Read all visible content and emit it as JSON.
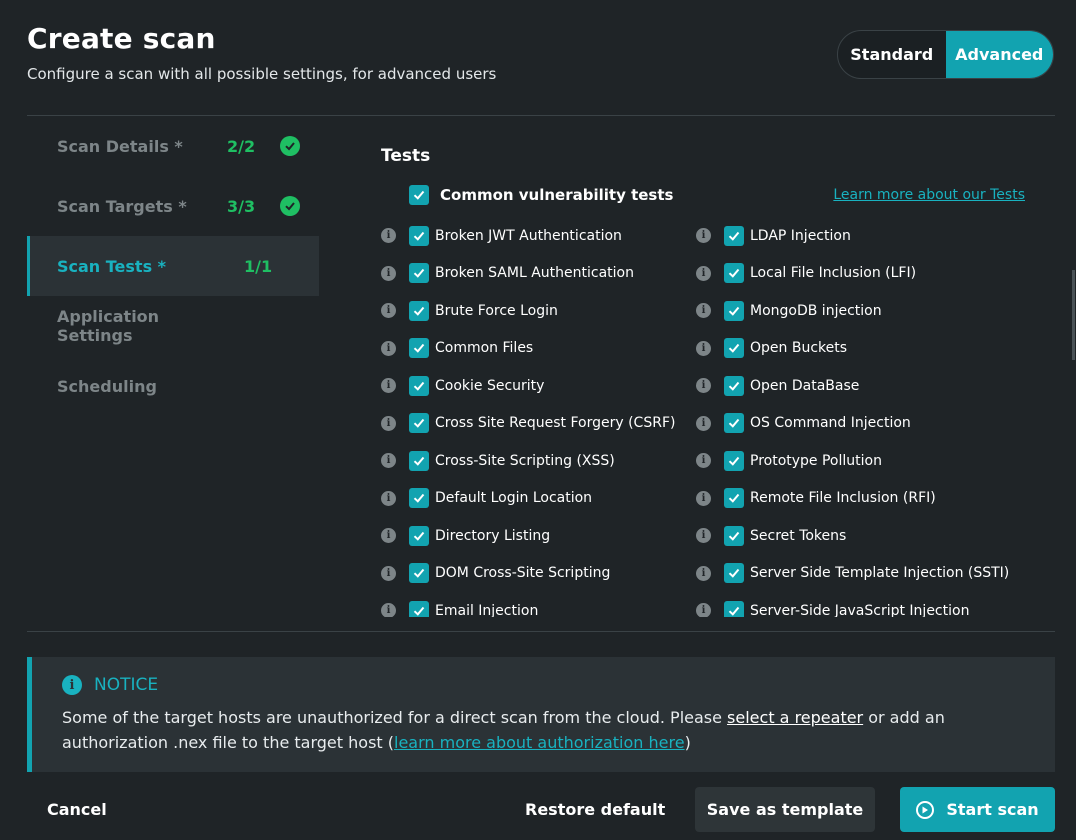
{
  "header": {
    "title": "Create scan",
    "subtitle": "Configure a scan with all possible settings, for advanced users"
  },
  "mode_toggle": {
    "standard_label": "Standard",
    "advanced_label": "Advanced",
    "selected": "Advanced"
  },
  "sidebar": {
    "items": [
      {
        "label": "Scan Details *",
        "count": "2/2",
        "complete": true
      },
      {
        "label": "Scan Targets *",
        "count": "3/3",
        "complete": true
      },
      {
        "label": "Scan Tests *",
        "count": "1/1",
        "active": true
      },
      {
        "label": "Application Settings"
      },
      {
        "label": "Scheduling"
      }
    ]
  },
  "tests": {
    "title": "Tests",
    "common_label": "Common vulnerability tests",
    "learn_more": "Learn more about our Tests",
    "left": [
      "Broken JWT Authentication",
      "Broken SAML Authentication",
      "Brute Force Login",
      "Common Files",
      "Cookie Security",
      "Cross Site Request Forgery (CSRF)",
      "Cross-Site Scripting (XSS)",
      "Default Login Location",
      "Directory Listing",
      "DOM Cross-Site Scripting",
      "Email Injection"
    ],
    "right": [
      "LDAP Injection",
      "Local File Inclusion (LFI)",
      "MongoDB injection",
      "Open Buckets",
      "Open DataBase",
      "OS Command Injection",
      "Prototype Pollution",
      "Remote File Inclusion (RFI)",
      "Secret Tokens",
      "Server Side Template Injection (SSTI)",
      "Server-Side JavaScript Injection"
    ]
  },
  "notice": {
    "title": "NOTICE",
    "text_1": "Some of the target hosts are unauthorized for a direct scan from the cloud. Please ",
    "link_repeater": "select a repeater",
    "text_2": " or add an authorization .nex file to the target host (",
    "link_auth": "learn more about authorization here",
    "text_3": ")"
  },
  "footer": {
    "cancel": "Cancel",
    "restore": "Restore default",
    "save_template": "Save as template",
    "start_scan": "Start scan"
  },
  "colors": {
    "accent": "#12a3b0",
    "success": "#1fbf63",
    "background": "#1f2427"
  }
}
